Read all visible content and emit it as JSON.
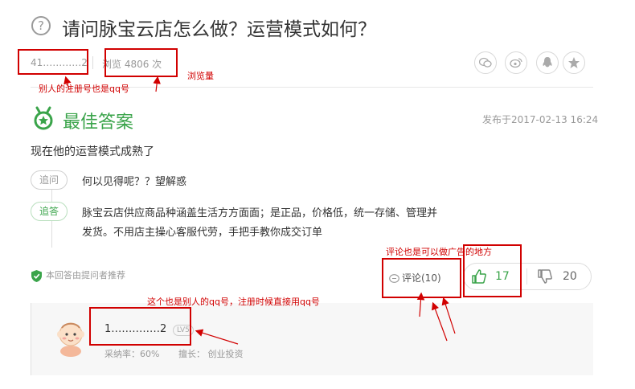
{
  "question": {
    "icon": "question-circle-icon",
    "title": "请问脉宝云店怎么做？运营模式如何？",
    "user_id": "41…………2",
    "views": "浏览 4806 次"
  },
  "share_icons": [
    "wechat-icon",
    "weibo-icon",
    "qq-icon",
    "star-icon"
  ],
  "best_answer": {
    "icon": "medal-icon",
    "title": "最佳答案",
    "published": "发布于2017-02-13 16:24",
    "text": "现在他的运营模式成熟了",
    "followups": [
      {
        "tag": "追问",
        "text": "何以见得呢？？望解惑"
      },
      {
        "tag": "追答",
        "line1": "脉宝云店供应商品种涵盖生活方方面面；是正品，价格低，统一存储、管理并",
        "line2": "发货。不用店主操心客服代劳，手把手教你成交订单"
      }
    ],
    "recommend": "本回答由提问者推荐",
    "comment": "评论(10)",
    "likes": "17",
    "dislikes": "20"
  },
  "answerer": {
    "name": "1‥‥‥‥‥‥‥2",
    "level": "LV5",
    "adopt_rate": "采纳率：60%",
    "expertise": "擅长： 创业投资"
  },
  "annotations": {
    "note_user_id": "别人的注册号也是qq号",
    "note_views": "浏览量",
    "note_comments": "评论也是可以做广告的地方",
    "note_answerer": "这个也是别人的qq号，注册时候直接用qq号",
    "color": "#d10000"
  },
  "colors": {
    "accent_green": "#3aa44a",
    "annotation_red": "#d10000"
  }
}
